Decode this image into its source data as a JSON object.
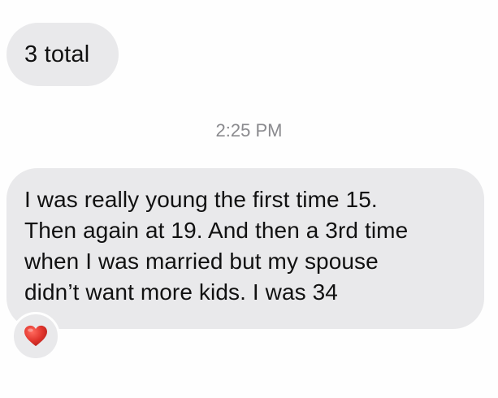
{
  "messages": [
    {
      "text": "3 total"
    },
    {
      "lines": [
        "I was really young the first time 15.",
        "Then again at 19. And then a 3rd time",
        "when I was married but my spouse",
        "didn’t want more kids. I was 34"
      ],
      "reaction": "heart-icon"
    }
  ],
  "timestamp": "2:25 PM",
  "colors": {
    "bubble": "#e9e9eb",
    "timestamp": "#8a8a8e",
    "heart": "#e0342c"
  }
}
